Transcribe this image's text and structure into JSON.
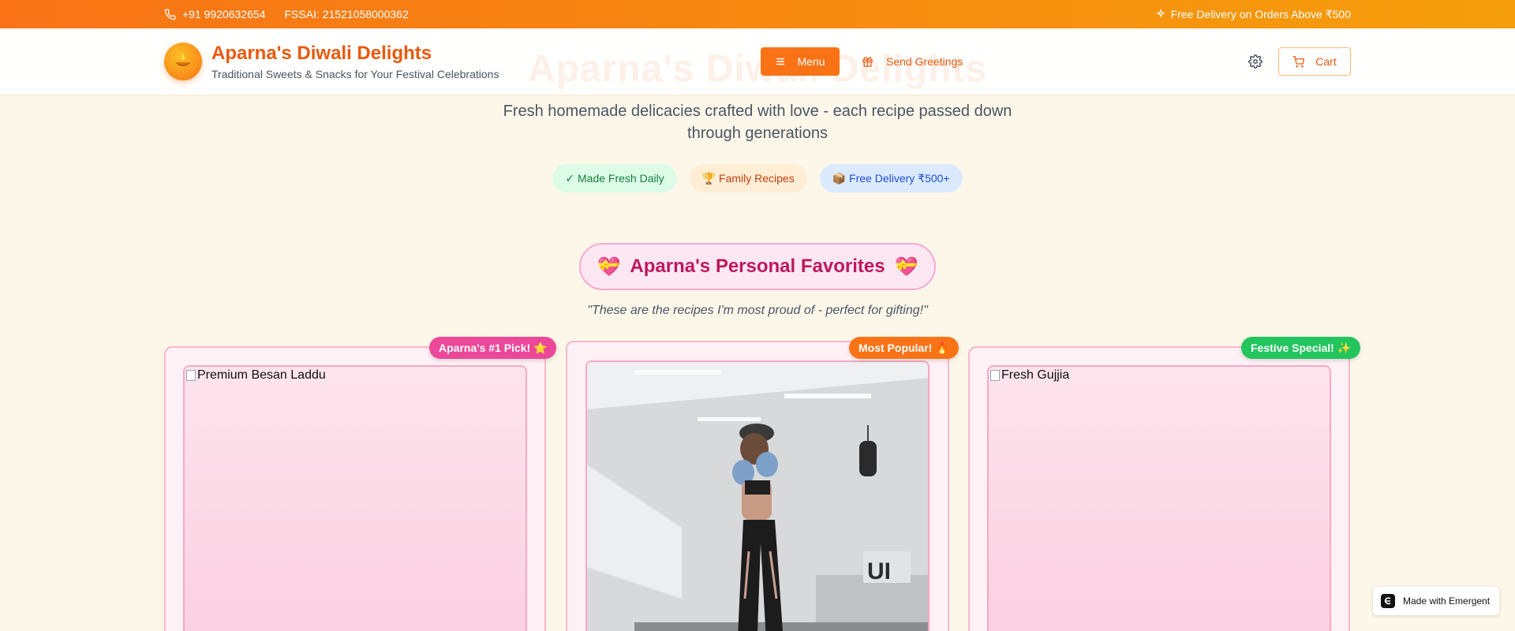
{
  "topbar": {
    "phone": "+91 9920632654",
    "fssai": "FSSAI: 21521058000362",
    "delivery_notice": "Free Delivery on Orders Above ₹500"
  },
  "header": {
    "ghost_title": "Aparna's Diwali Delights",
    "brand_title": "Aparna's Diwali Delights",
    "brand_subtitle": "Traditional Sweets & Snacks for Your Festival Celebrations",
    "logo_icon": "diya-icon",
    "menu_label": "Menu",
    "greetings_label": "Send Greetings",
    "cart_label": "Cart"
  },
  "hero": {
    "subtitle": "Fresh homemade delicacies crafted with love - each recipe passed down through generations",
    "pills": [
      {
        "label": "✓ Made Fresh Daily",
        "color": "#15803d"
      },
      {
        "label": "🏆 Family Recipes",
        "color": "#c2410c"
      },
      {
        "label": "📦 Free Delivery ₹500+",
        "color": "#1d4ed8"
      }
    ]
  },
  "favorites": {
    "title": "Aparna's Personal Favorites",
    "quote": "\"These are the recipes I'm most proud of - perfect for gifting!\"",
    "cards": [
      {
        "ribbon": "Aparna's #1 Pick! ⭐",
        "image_alt": "Premium Besan Laddu"
      },
      {
        "ribbon": "Most Popular! 🔥",
        "image_alt": ""
      },
      {
        "ribbon": "Festive Special! ✨",
        "image_alt": "Fresh Gujjia"
      }
    ]
  },
  "badge": {
    "label": "Made with Emergent"
  },
  "colors": {
    "accent": "#f97316",
    "brand": "#ea580c",
    "pink": "#be185d"
  }
}
